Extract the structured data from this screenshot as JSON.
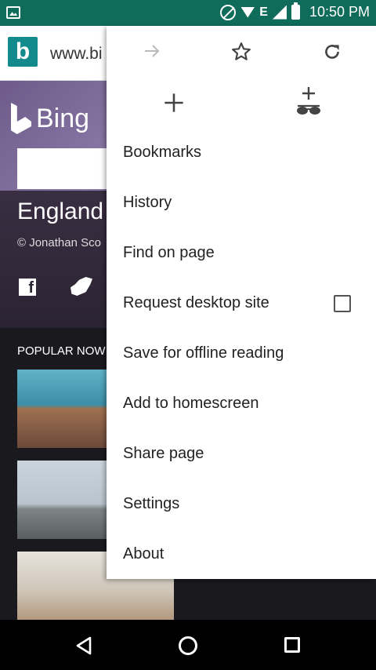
{
  "status_bar": {
    "time": "10:50 PM",
    "network_letter": "E"
  },
  "browser": {
    "url": "www.bi",
    "favicon_letter": "b"
  },
  "page": {
    "brand": "Bing",
    "headline": "England",
    "credit": "© Jonathan Sco",
    "popular_label": "POPULAR NOW",
    "social": {
      "facebook": "f"
    }
  },
  "menu": {
    "icons": [
      "forward-icon",
      "star-icon",
      "refresh-icon",
      "new-tab-icon",
      "incognito-icon"
    ],
    "items": [
      {
        "label": "Bookmarks"
      },
      {
        "label": "History"
      },
      {
        "label": "Find on page"
      },
      {
        "label": "Request desktop site",
        "checkbox": false
      },
      {
        "label": "Save for offline reading"
      },
      {
        "label": "Add to homescreen"
      },
      {
        "label": "Share page"
      },
      {
        "label": "Settings"
      },
      {
        "label": "About"
      }
    ]
  },
  "colors": {
    "status_bar": "#0f6b5a",
    "bing_teal": "#138a8c",
    "menu_bg": "#ffffff"
  }
}
